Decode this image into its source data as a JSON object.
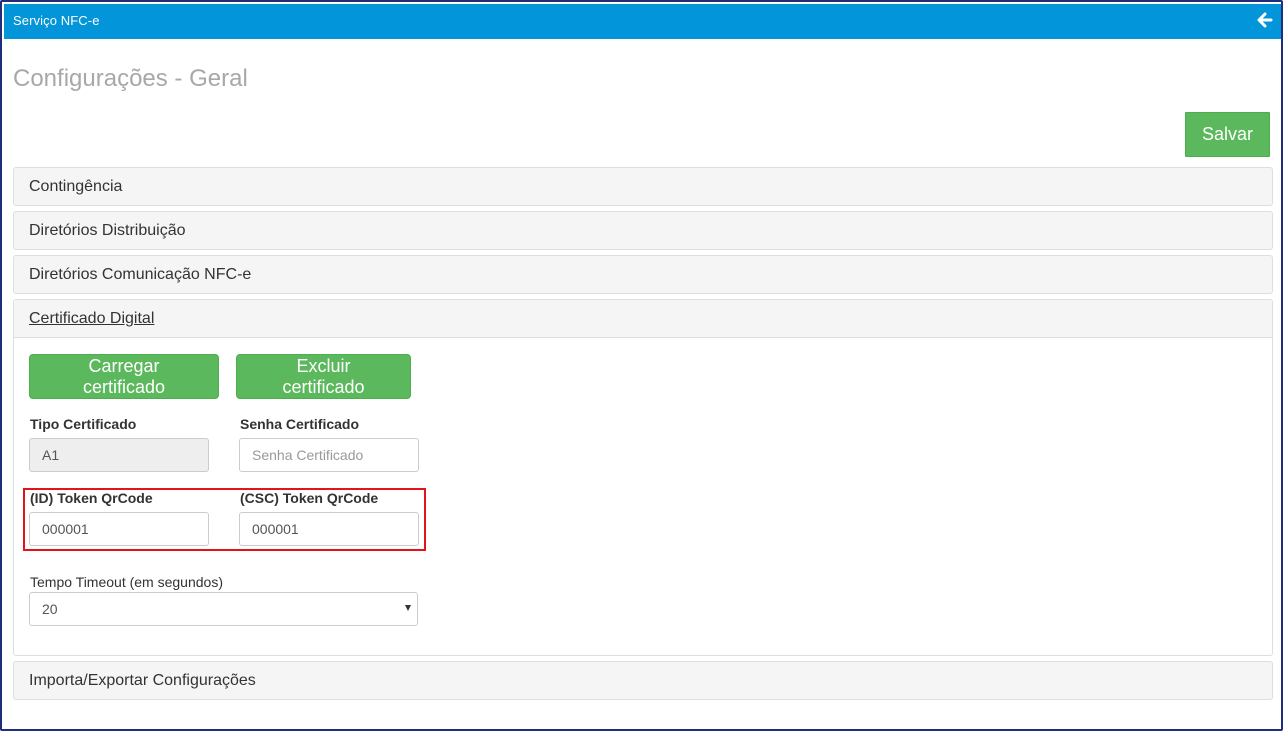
{
  "app": {
    "title": "Serviço NFC-e",
    "back_icon": "arrow-left-icon"
  },
  "page": {
    "title": "Configurações - Geral"
  },
  "toolbar": {
    "save_label": "Salvar"
  },
  "panels": {
    "contingencia": "Contingência",
    "diretorios_distribuicao": "Diretórios Distribuição",
    "diretorios_comunicacao": "Diretórios Comunicação NFC-e",
    "certificado_digital": "Certificado Digital",
    "importa_exportar": "Importa/Exportar Configurações"
  },
  "certificado": {
    "load_label": "Carregar certificado",
    "delete_label": "Excluir certificado",
    "tipo_label": "Tipo Certificado",
    "tipo_value": "A1",
    "senha_label": "Senha Certificado",
    "senha_placeholder": "Senha Certificado",
    "id_token_label": "(ID) Token QrCode",
    "id_token_value": "000001",
    "csc_token_label": "(CSC) Token QrCode",
    "csc_token_value": "000001",
    "timeout_label": "Tempo Timeout (em segundos)",
    "timeout_value": "20"
  },
  "colors": {
    "topbar": "#0295d9",
    "success": "#5cb85c",
    "highlight": "#e2131b",
    "title": "#a8a8a8"
  }
}
